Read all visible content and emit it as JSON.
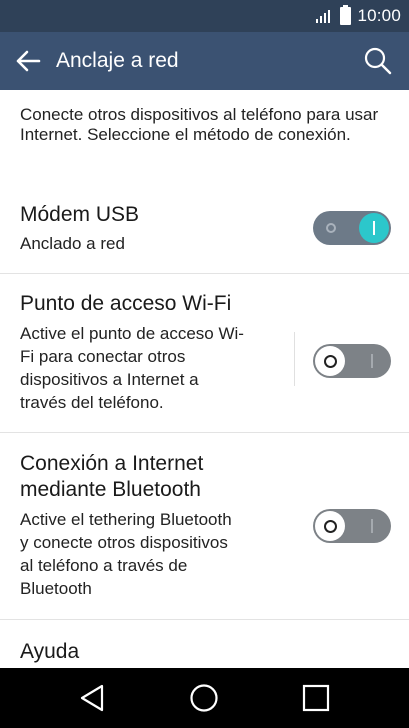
{
  "status_bar": {
    "time": "10:00",
    "icons": [
      "signal-icon",
      "battery-icon"
    ]
  },
  "app_bar": {
    "title": "Anclaje a red",
    "back_icon": "arrow-left-icon",
    "search_icon": "search-icon"
  },
  "intro": "Conecte otros dispositivos al teléfono para usar Internet. Seleccione el método de conexión.",
  "settings": [
    {
      "title": "Módem USB",
      "summary": "Anclado a red",
      "enabled": true
    },
    {
      "title": "Punto de acceso Wi-Fi",
      "summary_lines": [
        "Active el punto de acceso Wi-",
        "Fi para conectar otros",
        "dispositivos a Internet a",
        "través del teléfono."
      ],
      "enabled": false
    },
    {
      "title_lines": [
        "Conexión a Internet",
        "mediante Bluetooth"
      ],
      "summary_lines": [
        "Active el tethering Bluetooth",
        "y conecte otros dispositivos",
        "al teléfono a través de",
        "Bluetooth"
      ],
      "enabled": false
    }
  ],
  "help": {
    "title": "Ayuda"
  },
  "nav_bar": {
    "icons": [
      "back-triangle-icon",
      "home-circle-icon",
      "recents-square-icon"
    ]
  },
  "colors": {
    "status_bar": "#2f4158",
    "app_bar": "#3b5272",
    "toggle_on": "#2cc7cb",
    "nav_bar": "#000000"
  }
}
